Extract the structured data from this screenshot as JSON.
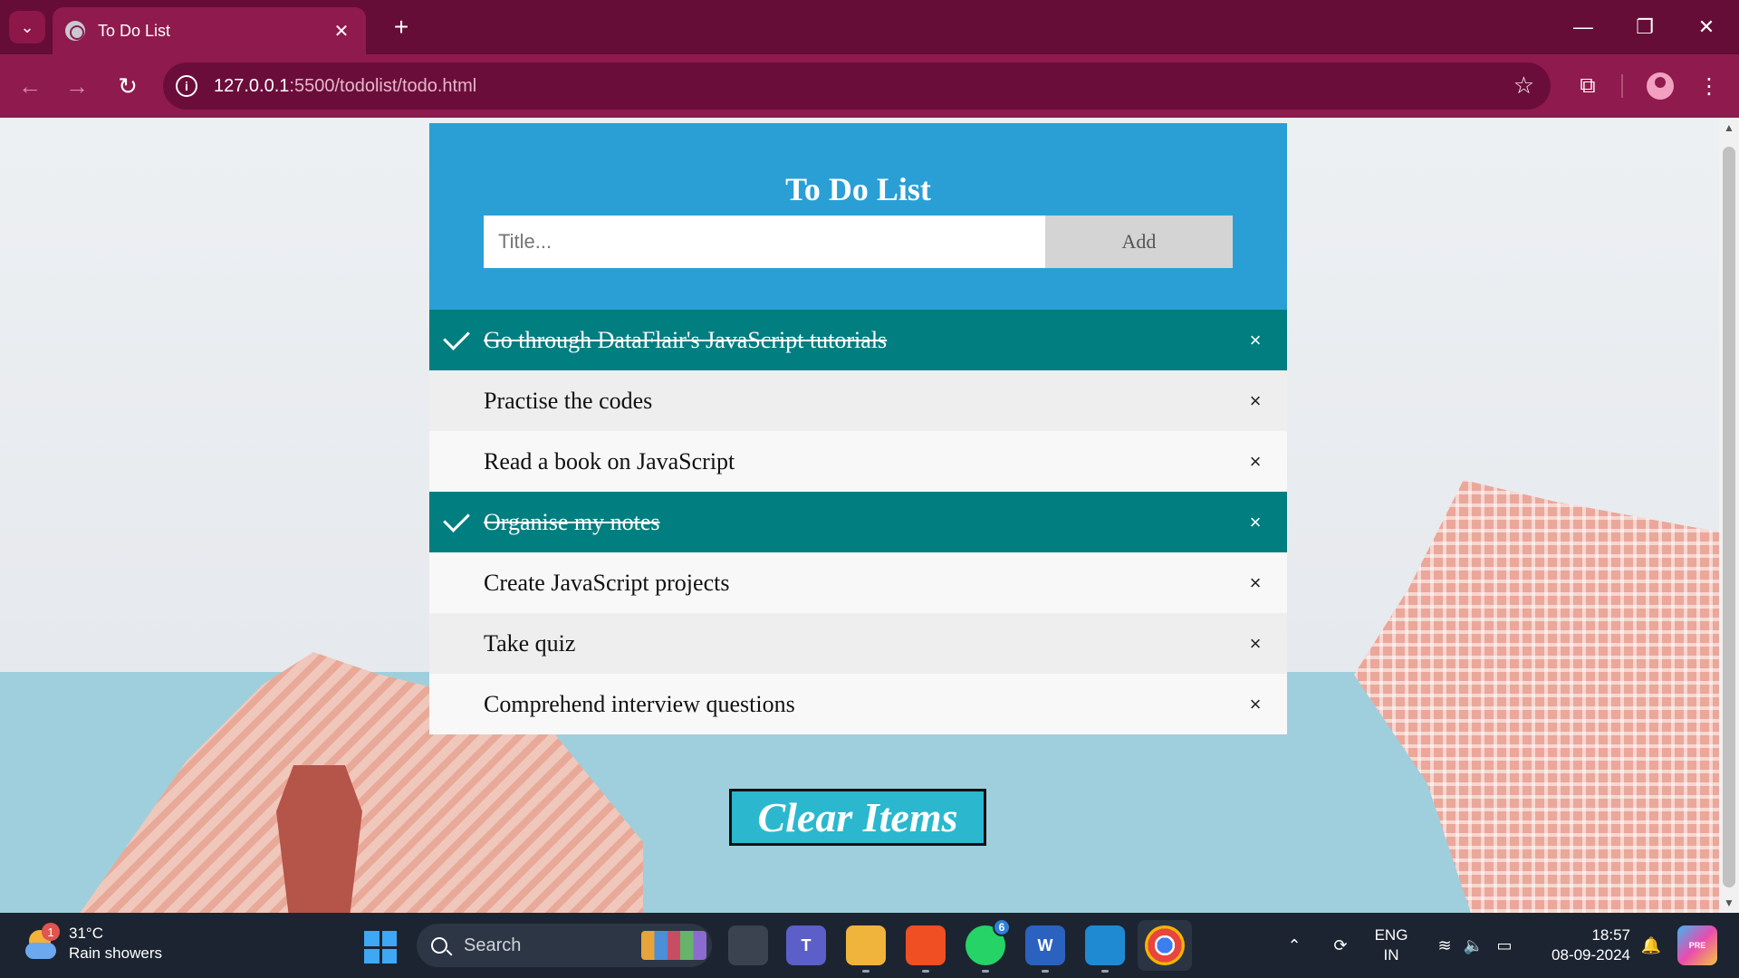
{
  "browser": {
    "tab_title": "To Do List",
    "tab_close": "✕",
    "new_tab": "+",
    "url_host": "127.0.0.1",
    "url_path": ":5500/todolist/todo.html",
    "icons": [
      "tab-search-icon",
      "globe-icon",
      "back-icon",
      "forward-icon",
      "reload-icon",
      "info-icon",
      "star-icon",
      "extensions-icon",
      "profile-icon",
      "menu-icon"
    ]
  },
  "app": {
    "title": "To Do List",
    "input_placeholder": "Title...",
    "add_label": "Add",
    "remove_glyph": "×",
    "items": [
      {
        "text": "Go through DataFlair's JavaScript tutorials",
        "checked": true
      },
      {
        "text": "Practise the codes",
        "checked": false
      },
      {
        "text": "Read a book on JavaScript",
        "checked": false
      },
      {
        "text": "Organise my notes",
        "checked": true
      },
      {
        "text": "Create JavaScript projects",
        "checked": false
      },
      {
        "text": "Take quiz",
        "checked": false
      },
      {
        "text": "Comprehend interview questions",
        "checked": false
      }
    ],
    "clear_label": "Clear Items",
    "colors": {
      "header": "#2a9fd6",
      "checked": "#017e80",
      "clear_button": "#2bb8cf"
    }
  },
  "taskbar": {
    "weather_temp": "31°C",
    "weather_desc": "Rain showers",
    "weather_badge": "1",
    "search_label": "Search",
    "whatsapp_badge": "6",
    "word_label": "W",
    "teams_label": "T",
    "lang_top": "ENG",
    "lang_bottom": "IN",
    "time": "18:57",
    "date": "08-09-2024",
    "copilot_label": "PRE"
  }
}
